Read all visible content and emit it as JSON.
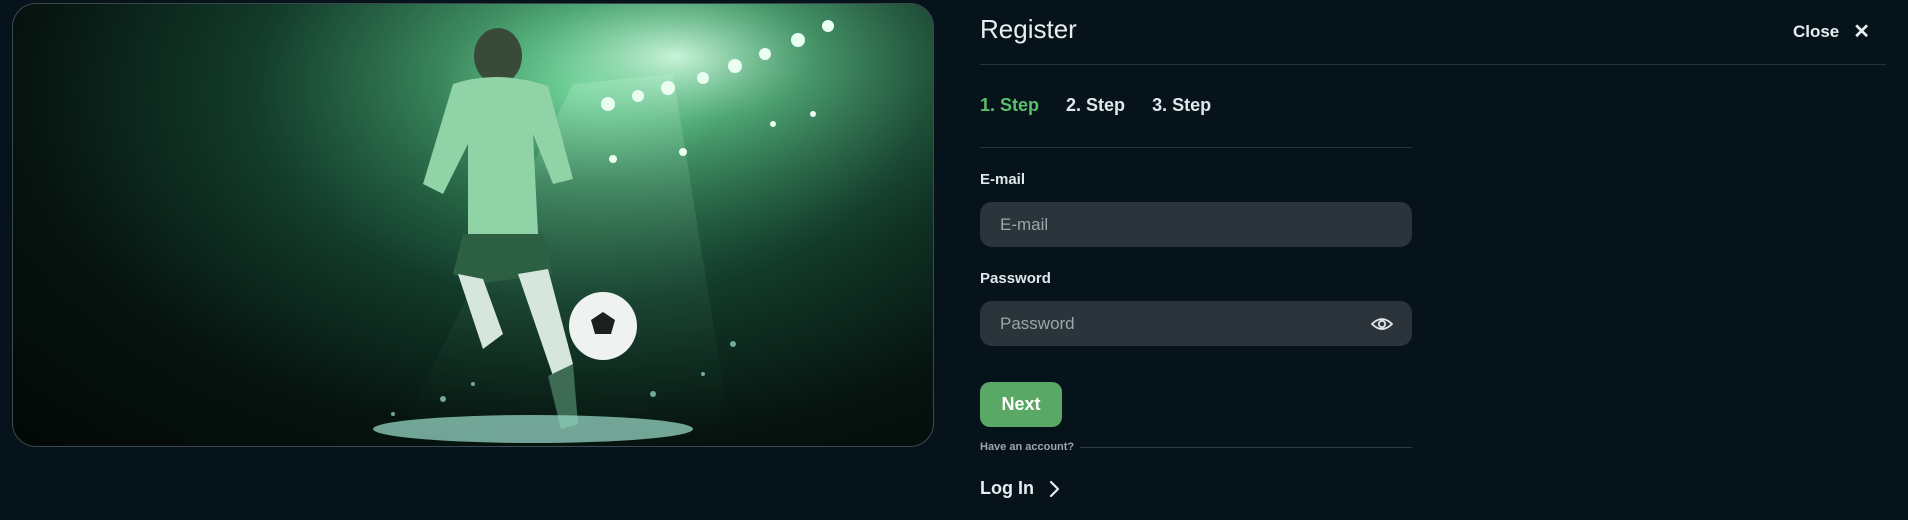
{
  "header": {
    "title": "Register",
    "close_label": "Close"
  },
  "steps": [
    {
      "label": "1. Step",
      "active": true
    },
    {
      "label": "2. Step",
      "active": false
    },
    {
      "label": "3. Step",
      "active": false
    }
  ],
  "form": {
    "email": {
      "label": "E-mail",
      "placeholder": "E-mail",
      "value": ""
    },
    "password": {
      "label": "Password",
      "placeholder": "Password",
      "value": ""
    },
    "next_label": "Next"
  },
  "footer": {
    "have_account": "Have an account?",
    "login_label": "Log In"
  },
  "colors": {
    "accent": "#5bbf6c",
    "button": "#5aa865",
    "background": "#07131a",
    "field": "#2a343a"
  },
  "icons": {
    "close": "close-icon",
    "password_toggle": "eye-icon",
    "login_arrow": "chevron-right-icon"
  }
}
